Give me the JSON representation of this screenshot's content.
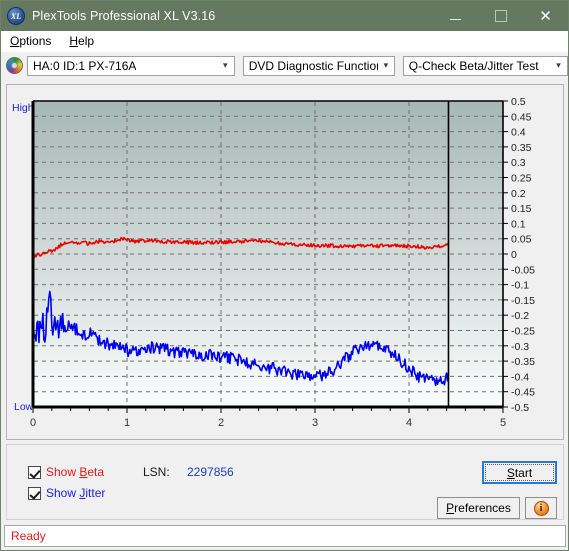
{
  "window": {
    "title": "PlexTools Professional XL V3.16",
    "icon": "xl-disc-icon",
    "titlebar_color": "#64795f",
    "minimize_label": "—",
    "maximize_label": "□",
    "close_label": "✕"
  },
  "menubar": {
    "items": [
      {
        "label": "Options",
        "accel": "O"
      },
      {
        "label": "Help",
        "accel": "H"
      }
    ]
  },
  "toolbar": {
    "drive_icon": "cd-disc-icon",
    "combos": [
      {
        "name": "drive-selector",
        "value": "HA:0 ID:1  PX-716A"
      },
      {
        "name": "function-selector",
        "value": "DVD Diagnostic Functions"
      },
      {
        "name": "test-selector",
        "value": "Q-Check Beta/Jitter Test"
      }
    ],
    "dropdown_arrow": "∨"
  },
  "chart_labels": {
    "high": "High",
    "low": "Low"
  },
  "controls": {
    "show_beta": {
      "label": "Show Beta",
      "accel": "B",
      "checked": true,
      "color": "#e01b1b"
    },
    "show_jitter": {
      "label": "Show Jitter",
      "accel": "J",
      "checked": true,
      "color": "#2020e0"
    },
    "lsn_label": "LSN:",
    "lsn_value": "2297856",
    "start_button": {
      "label": "Start",
      "accel": "S",
      "focused": true
    },
    "preferences_button": {
      "label": "Preferences",
      "accel": "P"
    },
    "info_button": {
      "label": "i",
      "name": "info-icon"
    }
  },
  "statusbar": {
    "text": "Ready",
    "color": "#e01b1b"
  },
  "chart_data": {
    "type": "line",
    "title": "Q-Check Beta/Jitter Test",
    "xlabel": "",
    "ylabel": "",
    "xlim": [
      0,
      5
    ],
    "ylim": [
      -0.5,
      0.5
    ],
    "grid": true,
    "legend_position": "external-checkboxes",
    "x_ticks": [
      0,
      1,
      2,
      3,
      4,
      5
    ],
    "x_minor_tick_step": 0.2,
    "y_ticks": [
      0.5,
      0.45,
      0.4,
      0.35,
      0.3,
      0.25,
      0.2,
      0.15,
      0.1,
      0.05,
      0,
      -0.05,
      -0.1,
      -0.15,
      -0.2,
      -0.25,
      -0.3,
      -0.35,
      -0.4,
      -0.45,
      -0.5
    ],
    "y_tick_labels": [
      "0.5",
      "0.45",
      "0.4",
      "0.35",
      "0.3",
      "0.25",
      "0.2",
      "0.15",
      "0.1",
      "0.05",
      "0",
      "-0.05",
      "-0.1",
      "-0.15",
      "-0.2",
      "-0.25",
      "-0.3",
      "-0.35",
      "-0.4",
      "-0.45",
      "-0.5"
    ],
    "plot_bg_gradient": [
      "#a7b8b4",
      "#fbfdfd"
    ],
    "data_end_marker_x": 4.42,
    "annotations": [
      {
        "text": "High",
        "position": "top-left-outside",
        "color": "#2020c8"
      },
      {
        "text": "Low",
        "position": "bottom-left-outside",
        "color": "#2020c8"
      }
    ],
    "series": [
      {
        "name": "Beta",
        "color": "#ee0000",
        "x": [
          0.0,
          0.03,
          0.06,
          0.09,
          0.12,
          0.15,
          0.18,
          0.21,
          0.24,
          0.27,
          0.3,
          0.35,
          0.4,
          0.45,
          0.5,
          0.55,
          0.6,
          0.65,
          0.7,
          0.75,
          0.8,
          0.85,
          0.9,
          0.95,
          1.0,
          1.05,
          1.1,
          1.15,
          1.2,
          1.25,
          1.3,
          1.35,
          1.4,
          1.45,
          1.5,
          1.6,
          1.7,
          1.8,
          1.9,
          2.0,
          2.1,
          2.2,
          2.3,
          2.4,
          2.5,
          2.6,
          2.7,
          2.8,
          2.9,
          3.0,
          3.1,
          3.2,
          3.3,
          3.4,
          3.5,
          3.6,
          3.7,
          3.8,
          3.9,
          4.0,
          4.1,
          4.2,
          4.3,
          4.42
        ],
        "y": [
          -0.01,
          -0.004,
          0.002,
          -0.006,
          0.008,
          0.0,
          0.014,
          0.006,
          0.018,
          0.024,
          0.03,
          0.034,
          0.036,
          0.035,
          0.038,
          0.036,
          0.034,
          0.037,
          0.04,
          0.038,
          0.036,
          0.042,
          0.046,
          0.05,
          0.048,
          0.044,
          0.04,
          0.044,
          0.042,
          0.044,
          0.042,
          0.04,
          0.041,
          0.04,
          0.039,
          0.038,
          0.038,
          0.037,
          0.038,
          0.039,
          0.04,
          0.041,
          0.043,
          0.045,
          0.04,
          0.036,
          0.032,
          0.03,
          0.029,
          0.028,
          0.027,
          0.027,
          0.026,
          0.026,
          0.026,
          0.027,
          0.027,
          0.027,
          0.027,
          0.026,
          0.024,
          0.022,
          0.024,
          0.03
        ]
      },
      {
        "name": "Jitter",
        "color": "#0000ee",
        "x": [
          0.0,
          0.03,
          0.06,
          0.09,
          0.12,
          0.15,
          0.18,
          0.21,
          0.24,
          0.27,
          0.3,
          0.35,
          0.4,
          0.45,
          0.5,
          0.55,
          0.6,
          0.65,
          0.7,
          0.75,
          0.8,
          0.85,
          0.9,
          0.95,
          1.0,
          1.05,
          1.1,
          1.15,
          1.2,
          1.25,
          1.3,
          1.35,
          1.4,
          1.45,
          1.5,
          1.6,
          1.7,
          1.8,
          1.9,
          2.0,
          2.1,
          2.2,
          2.3,
          2.4,
          2.5,
          2.6,
          2.7,
          2.8,
          2.9,
          3.0,
          3.1,
          3.2,
          3.3,
          3.4,
          3.5,
          3.55,
          3.6,
          3.65,
          3.7,
          3.8,
          3.9,
          4.0,
          4.1,
          4.2,
          4.3,
          4.42
        ],
        "y": [
          -0.25,
          -0.235,
          -0.25,
          -0.23,
          -0.245,
          -0.215,
          -0.16,
          -0.225,
          -0.23,
          -0.24,
          -0.215,
          -0.25,
          -0.235,
          -0.245,
          -0.255,
          -0.265,
          -0.255,
          -0.27,
          -0.28,
          -0.29,
          -0.295,
          -0.3,
          -0.305,
          -0.31,
          -0.315,
          -0.318,
          -0.322,
          -0.318,
          -0.312,
          -0.308,
          -0.305,
          -0.308,
          -0.312,
          -0.316,
          -0.32,
          -0.325,
          -0.328,
          -0.33,
          -0.332,
          -0.335,
          -0.34,
          -0.348,
          -0.355,
          -0.362,
          -0.37,
          -0.378,
          -0.385,
          -0.392,
          -0.398,
          -0.402,
          -0.395,
          -0.38,
          -0.35,
          -0.32,
          -0.3,
          -0.295,
          -0.298,
          -0.3,
          -0.305,
          -0.32,
          -0.345,
          -0.375,
          -0.4,
          -0.412,
          -0.418,
          -0.405
        ]
      }
    ]
  }
}
